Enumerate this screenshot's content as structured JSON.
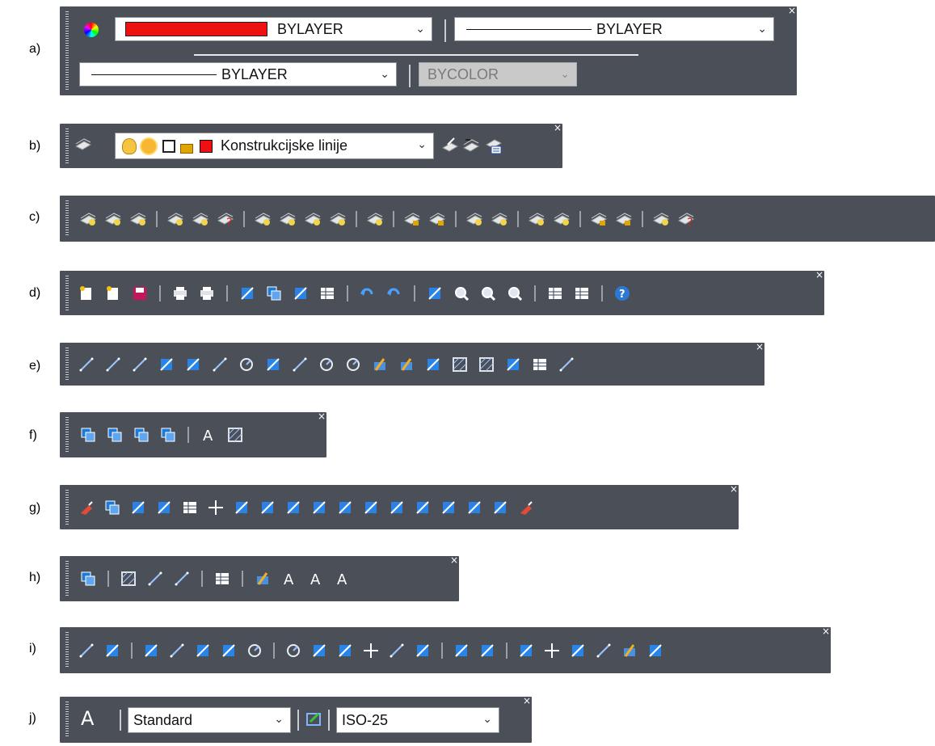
{
  "labels": [
    "a)",
    "b)",
    "c)",
    "d)",
    "e)",
    "f)",
    "g)",
    "h)",
    "i)",
    "j)"
  ],
  "close_glyph": "×",
  "dropdown_glyph": "⌄",
  "properties": {
    "color_value": "BYLAYER",
    "color_swatch": "#ee1111",
    "linetype_value": "BYLAYER",
    "lineweight_value": "BYLAYER",
    "plotstyle_value": "BYCOLOR"
  },
  "layers": {
    "current_layer": "Konstrukcijske linije",
    "layer_color": "#ee1111"
  },
  "styles": {
    "text_style": "Standard",
    "dim_style": "ISO-25"
  },
  "toolbars": {
    "c": [
      "layer-match-icon",
      "layer-previous-icon",
      "layer-walk-icon",
      "layer-off-icon",
      "layer-check-icon",
      "layer-delete-icon",
      "layer-isolate-icon",
      "layer-unisolate-icon",
      "layer-freeze-icon",
      "layer-merge-icon",
      "layer-thaw-icon",
      "layer-lock-icon",
      "layer-unlock-icon",
      "layer-on-icon",
      "layer-on-all-icon",
      "layer-new-icon",
      "layer-new-vp-icon",
      "layer-lock-fade-icon",
      "layer-unlock-all-icon",
      "layer-translate-icon",
      "layer-erase-icon"
    ],
    "d": [
      "new-icon",
      "open-icon",
      "save-icon",
      "print-icon",
      "plot-preview-icon",
      "cut-icon",
      "copy-icon",
      "paste-icon",
      "match-properties-icon",
      "undo-icon",
      "redo-icon",
      "pan-icon",
      "zoom-realtime-icon",
      "zoom-window-icon",
      "zoom-previous-icon",
      "sheet-set-icon",
      "properties-icon",
      "help-icon"
    ],
    "e": [
      "line-icon",
      "construction-line-icon",
      "polyline-icon",
      "polygon-icon",
      "rectangle-icon",
      "arc-icon",
      "circle-icon",
      "revision-cloud-icon",
      "spline-icon",
      "ellipse-icon",
      "ellipse-arc-icon",
      "insert-block-icon",
      "make-block-icon",
      "point-icon",
      "hatch-icon",
      "gradient-icon",
      "region-icon",
      "table-icon",
      "multiline-text-icon"
    ],
    "f": [
      "bring-to-front-icon",
      "send-to-back-icon",
      "bring-above-icon",
      "send-under-icon",
      "text-to-front-icon",
      "hatch-to-back-icon"
    ],
    "g": [
      "erase-icon",
      "copy-object-icon",
      "mirror-icon",
      "offset-icon",
      "array-icon",
      "move-icon",
      "rotate-icon",
      "scale-icon",
      "stretch-icon",
      "trim-icon",
      "extend-icon",
      "break-at-point-icon",
      "break-icon",
      "join-icon",
      "chamfer-icon",
      "fillet-icon",
      "blend-icon",
      "explode-icon"
    ],
    "h": [
      "draworder-icon",
      "edit-hatch-icon",
      "edit-polyline-icon",
      "edit-spline-icon",
      "edit-array-icon",
      "block-editor-icon",
      "edit-attribute-icon",
      "attribute-manager-icon",
      "block-attribute-icon"
    ],
    "i": [
      "linear-dim-icon",
      "aligned-dim-icon",
      "angular-dim-icon",
      "arc-length-icon",
      "ordinate-dim-icon",
      "jogged-dim-icon",
      "radius-dim-icon",
      "diameter-dim-icon",
      "angle-dim-icon",
      "quick-dim-icon",
      "center-mark-icon",
      "baseline-dim-icon",
      "continue-dim-icon",
      "dim-space-icon",
      "dim-break-icon",
      "tolerance-icon",
      "center-mark-2-icon",
      "inspect-icon",
      "jogged-linear-icon",
      "dim-edit-icon",
      "dim-update-icon"
    ]
  }
}
